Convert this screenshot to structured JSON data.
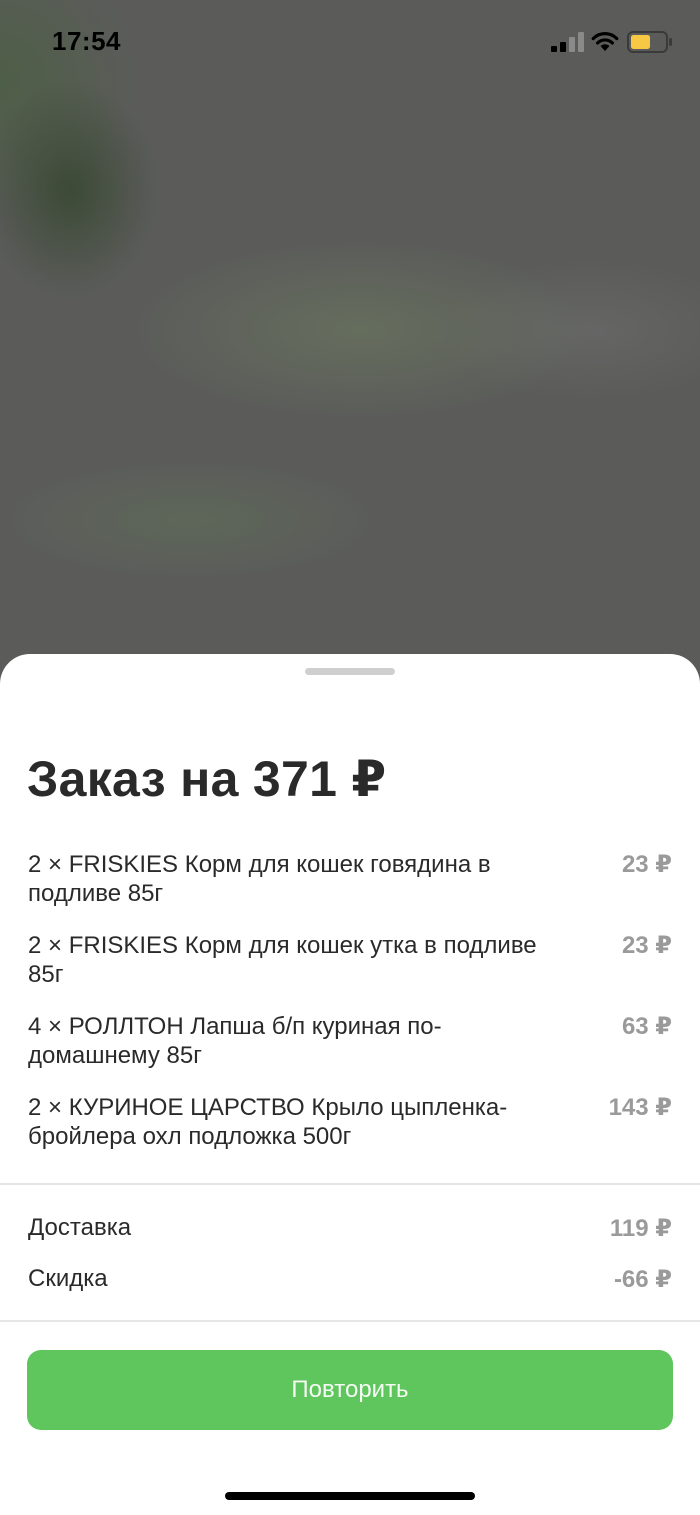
{
  "status_bar": {
    "time": "17:54",
    "icons": [
      "signal-icon",
      "wifi-icon",
      "battery-icon"
    ],
    "battery_color": "#f7c843"
  },
  "sheet": {
    "title": "Заказ на 371 ₽",
    "items": [
      {
        "name": "2 × FRISKIES Корм для кошек говядина в подливе 85г",
        "price": "23 ₽"
      },
      {
        "name": "2 × FRISKIES Корм для кошек утка в подливе 85г",
        "price": "23 ₽"
      },
      {
        "name": "4 × РОЛЛТОН Лапша б/п куриная по-домашнему 85г",
        "price": "63 ₽"
      },
      {
        "name": "2 × КУРИНОЕ ЦАРСТВО Крыло цыпленка-бройлера охл подложка 500г",
        "price": "143 ₽"
      }
    ],
    "delivery": {
      "label": "Доставка",
      "value": "119 ₽"
    },
    "discount": {
      "label": "Скидка",
      "value": "-66 ₽"
    },
    "repeat_button": "Повторить",
    "accent_color": "#5fc55d"
  }
}
